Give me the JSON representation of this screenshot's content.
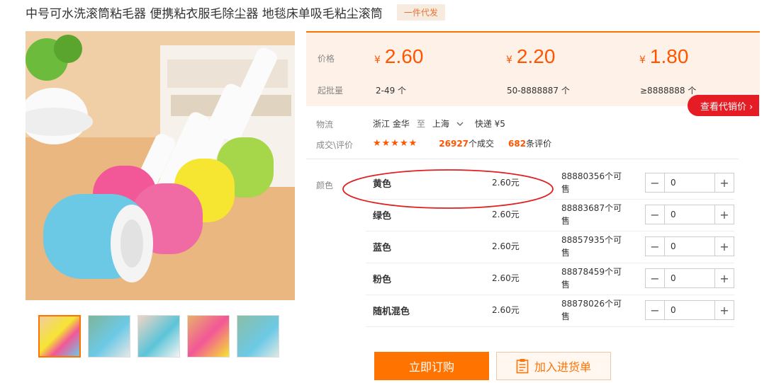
{
  "header": {
    "title": "中号可水洗滚筒粘毛器 便携粘衣服毛除尘器 地毯床单吸毛粘尘滚筒",
    "badge": "一件代发"
  },
  "gallery": {
    "main_image": "lint-roller-set-photo",
    "thumbnail_count": 5,
    "active_thumbnail": 1
  },
  "price_panel": {
    "price_label": "价格",
    "qty_label": "起批量",
    "currency": "¥",
    "tiers": [
      {
        "price": "2.60",
        "qty": "2-49 个"
      },
      {
        "price": "2.20",
        "qty": "50-8888887 个"
      },
      {
        "price": "1.80",
        "qty": "≥8888888 个"
      }
    ],
    "distribution_button": "查看代销价 ›"
  },
  "logistics": {
    "label": "物流",
    "from": "浙江 金华",
    "to_word": "至",
    "to": "上海",
    "shipping": "快递 ¥5"
  },
  "transactions": {
    "label": "成交\\评价",
    "stars": "★★★★★",
    "deals_count": "26927",
    "deals_label": "个成交",
    "reviews_count": "682",
    "reviews_label": "条评价"
  },
  "sku": {
    "label": "颜色",
    "rows": [
      {
        "name": "黄色",
        "price": "2.60元",
        "stock": "88880356个可售",
        "qty": "0"
      },
      {
        "name": "绿色",
        "price": "2.60元",
        "stock": "88883687个可售",
        "qty": "0"
      },
      {
        "name": "蓝色",
        "price": "2.60元",
        "stock": "88857935个可售",
        "qty": "0"
      },
      {
        "name": "粉色",
        "price": "2.60元",
        "stock": "88878459个可售",
        "qty": "0"
      },
      {
        "name": "随机混色",
        "price": "2.60元",
        "stock": "88878026个可售",
        "qty": "0"
      }
    ]
  },
  "actions": {
    "order": "立即订购",
    "cart": "加入进货单"
  },
  "colors": {
    "accent": "#ff7300",
    "price": "#ff5500",
    "annotation": "#e01f1f"
  }
}
